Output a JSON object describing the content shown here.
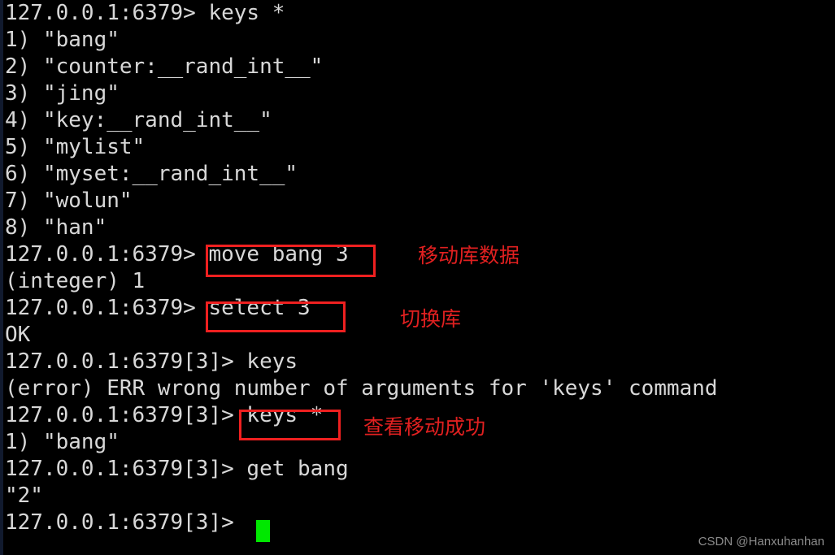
{
  "terminal": {
    "prompt_db0": "127.0.0.1:6379>",
    "prompt_db3": "127.0.0.1:6379[3]>",
    "lines": [
      "127.0.0.1:6379> keys *",
      "1) \"bang\"",
      "2) \"counter:__rand_int__\"",
      "3) \"jing\"",
      "4) \"key:__rand_int__\"",
      "5) \"mylist\"",
      "6) \"myset:__rand_int__\"",
      "7) \"wolun\"",
      "8) \"han\"",
      "127.0.0.1:6379> move bang 3",
      "(integer) 1",
      "127.0.0.1:6379> select 3",
      "OK",
      "127.0.0.1:6379[3]> keys",
      "(error) ERR wrong number of arguments for 'keys' command",
      "127.0.0.1:6379[3]> keys *",
      "1) \"bang\"",
      "127.0.0.1:6379[3]> get bang",
      "\"2\"",
      "127.0.0.1:6379[3]> "
    ],
    "cursor": {
      "name": "block-cursor",
      "color": "#00e800"
    },
    "colors": {
      "background": "#000000",
      "text": "#d8d8d8",
      "highlight_box": "#ef2020",
      "annotation": "#e02020"
    }
  },
  "highlights": [
    {
      "label": "move bang 3",
      "box": "box-move"
    },
    {
      "label": "select 3",
      "box": "box-select"
    },
    {
      "label": "keys *",
      "box": "box-keys"
    }
  ],
  "annotations": [
    {
      "id": "annot-1",
      "text": "移动库数据"
    },
    {
      "id": "annot-2",
      "text": "切换库"
    },
    {
      "id": "annot-3",
      "text": "查看移动成功"
    }
  ],
  "watermark": {
    "text": "CSDN @Hanxuhanhan"
  }
}
